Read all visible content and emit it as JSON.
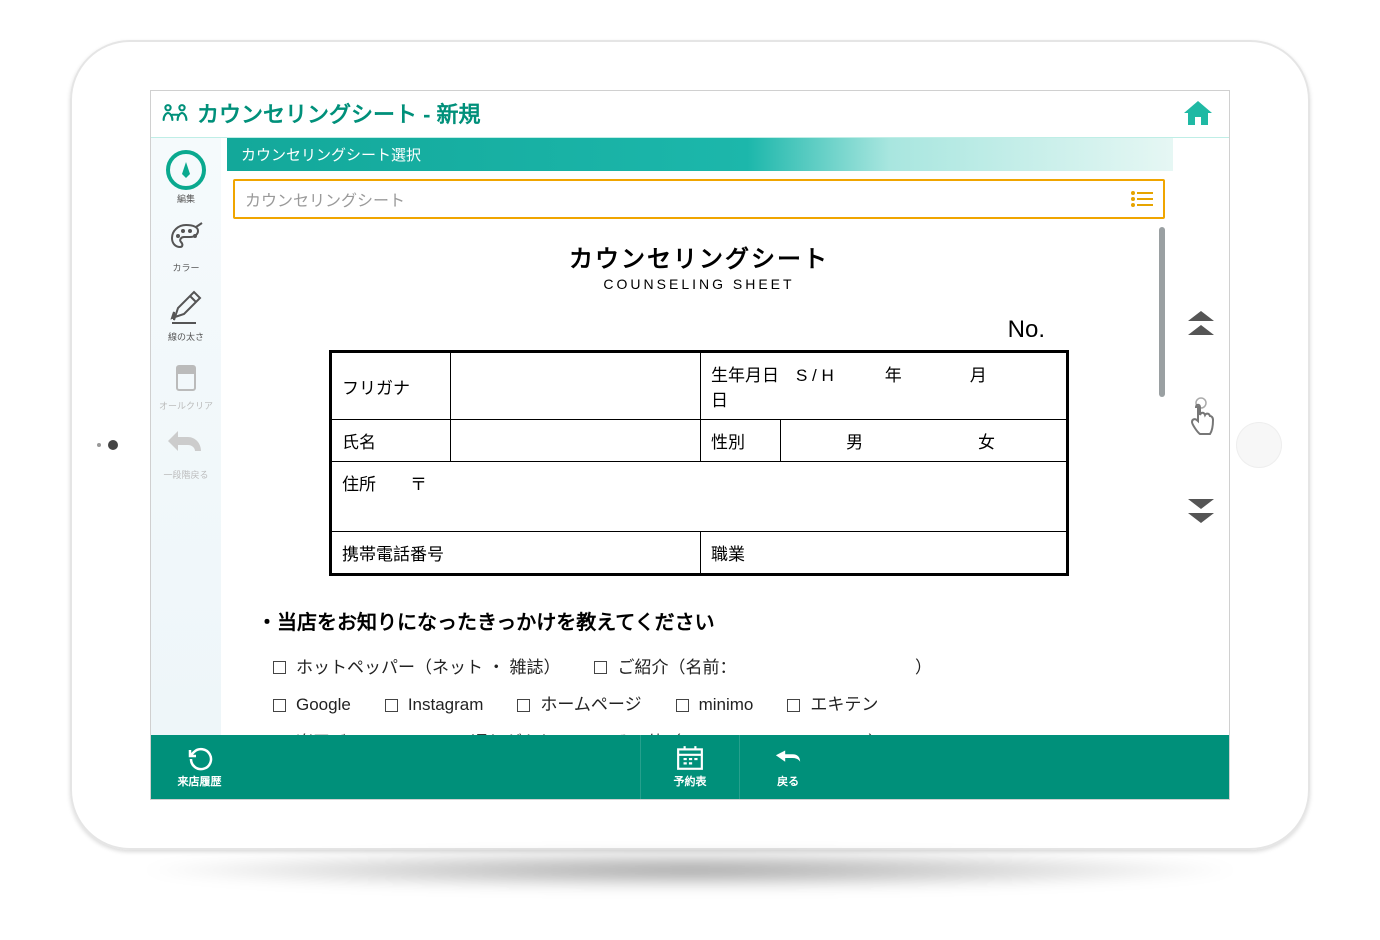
{
  "header": {
    "title": "カウンセリングシート - 新規"
  },
  "section_header": "カウンセリングシート選択",
  "selector": {
    "value": "カウンセリングシート"
  },
  "sidebar": {
    "items": [
      {
        "label": "編集"
      },
      {
        "label": "カラー"
      },
      {
        "label": "線の太さ"
      },
      {
        "label": "オールクリア"
      },
      {
        "label": "一段階戻る"
      }
    ]
  },
  "sheet": {
    "title_ja": "カウンセリングシート",
    "title_en": "COUNSELING SHEET",
    "no_label": "No.",
    "rows": {
      "furigana": "フリガナ",
      "birth": "生年月日　S / H　　　年　　　　月　　　　日",
      "name": "氏名",
      "gender_label": "性別",
      "gender_m": "男",
      "gender_f": "女",
      "address": "住所　　〒",
      "phone": "携帯電話番号",
      "job": "職業"
    },
    "q1": "・当店をお知りになったきっかけを教えてください",
    "choices_row1": [
      "ホットペッパー（ネット ・ 雑誌）",
      "ご紹介（名前：　　　　　　　　　　　）"
    ],
    "choices_row2": [
      "Google",
      "Instagram",
      "ホームページ",
      "minimo",
      "エキテン"
    ],
    "choices_row3": [
      "楽天ビューティ",
      "通りがかり",
      "その他（　　　　　　　　　　　）"
    ]
  },
  "bottom": {
    "history": "来店履歴",
    "calendar": "予約表",
    "back": "戻る"
  }
}
